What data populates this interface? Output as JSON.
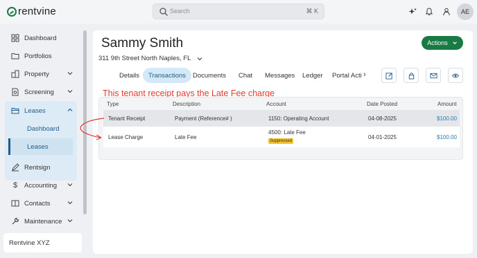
{
  "brand": {
    "name": "rentvine"
  },
  "search": {
    "placeholder": "Search",
    "shortcut": "⌘ K"
  },
  "user": {
    "initials": "AE"
  },
  "sidebar": {
    "items": [
      {
        "label": "Dashboard",
        "icon": "dashboard-icon"
      },
      {
        "label": "Portfolios",
        "icon": "folder-icon"
      },
      {
        "label": "Property",
        "icon": "building-icon"
      },
      {
        "label": "Screening",
        "icon": "document-search-icon"
      },
      {
        "label": "Leases",
        "icon": "folder-open-icon"
      },
      {
        "label": "Rentsign",
        "icon": "pen-icon"
      },
      {
        "label": "Accounting",
        "icon": "dollar-icon"
      },
      {
        "label": "Contacts",
        "icon": "contacts-icon"
      },
      {
        "label": "Maintenance",
        "icon": "wrench-icon"
      }
    ],
    "leases_sub": [
      "Dashboard",
      "Leases"
    ],
    "company": "Rentvine XYZ"
  },
  "tenant": {
    "name": "Sammy Smith",
    "address": "311 9th Street North Naples, FL",
    "actions_label": "Actions"
  },
  "tabs": [
    "Details",
    "Transactions",
    "Documents",
    "Chat",
    "Messages",
    "Ledger",
    "Portal Acti"
  ],
  "annotation": "This tenant receipt pays the Late Fee charge",
  "table": {
    "headers": [
      "Type",
      "Description",
      "Account",
      "Date Posted",
      "Amount"
    ],
    "rows": [
      {
        "type": "Tenant Receipt",
        "description": "Payment (Reference# )",
        "account": "1150: Operating Account",
        "date": "04-08-2025",
        "amount": "$100.00",
        "badge": ""
      },
      {
        "type": "Lease Charge",
        "description": "Late Fee",
        "account": "4500: Late Fee",
        "date": "04-01-2025",
        "amount": "$100.00",
        "badge": "Suppressed"
      }
    ]
  },
  "colors": {
    "brand": "#1a7a46",
    "accent": "#1e5d8a",
    "annotation": "#e23b2e",
    "badge": "#f2c12e"
  }
}
